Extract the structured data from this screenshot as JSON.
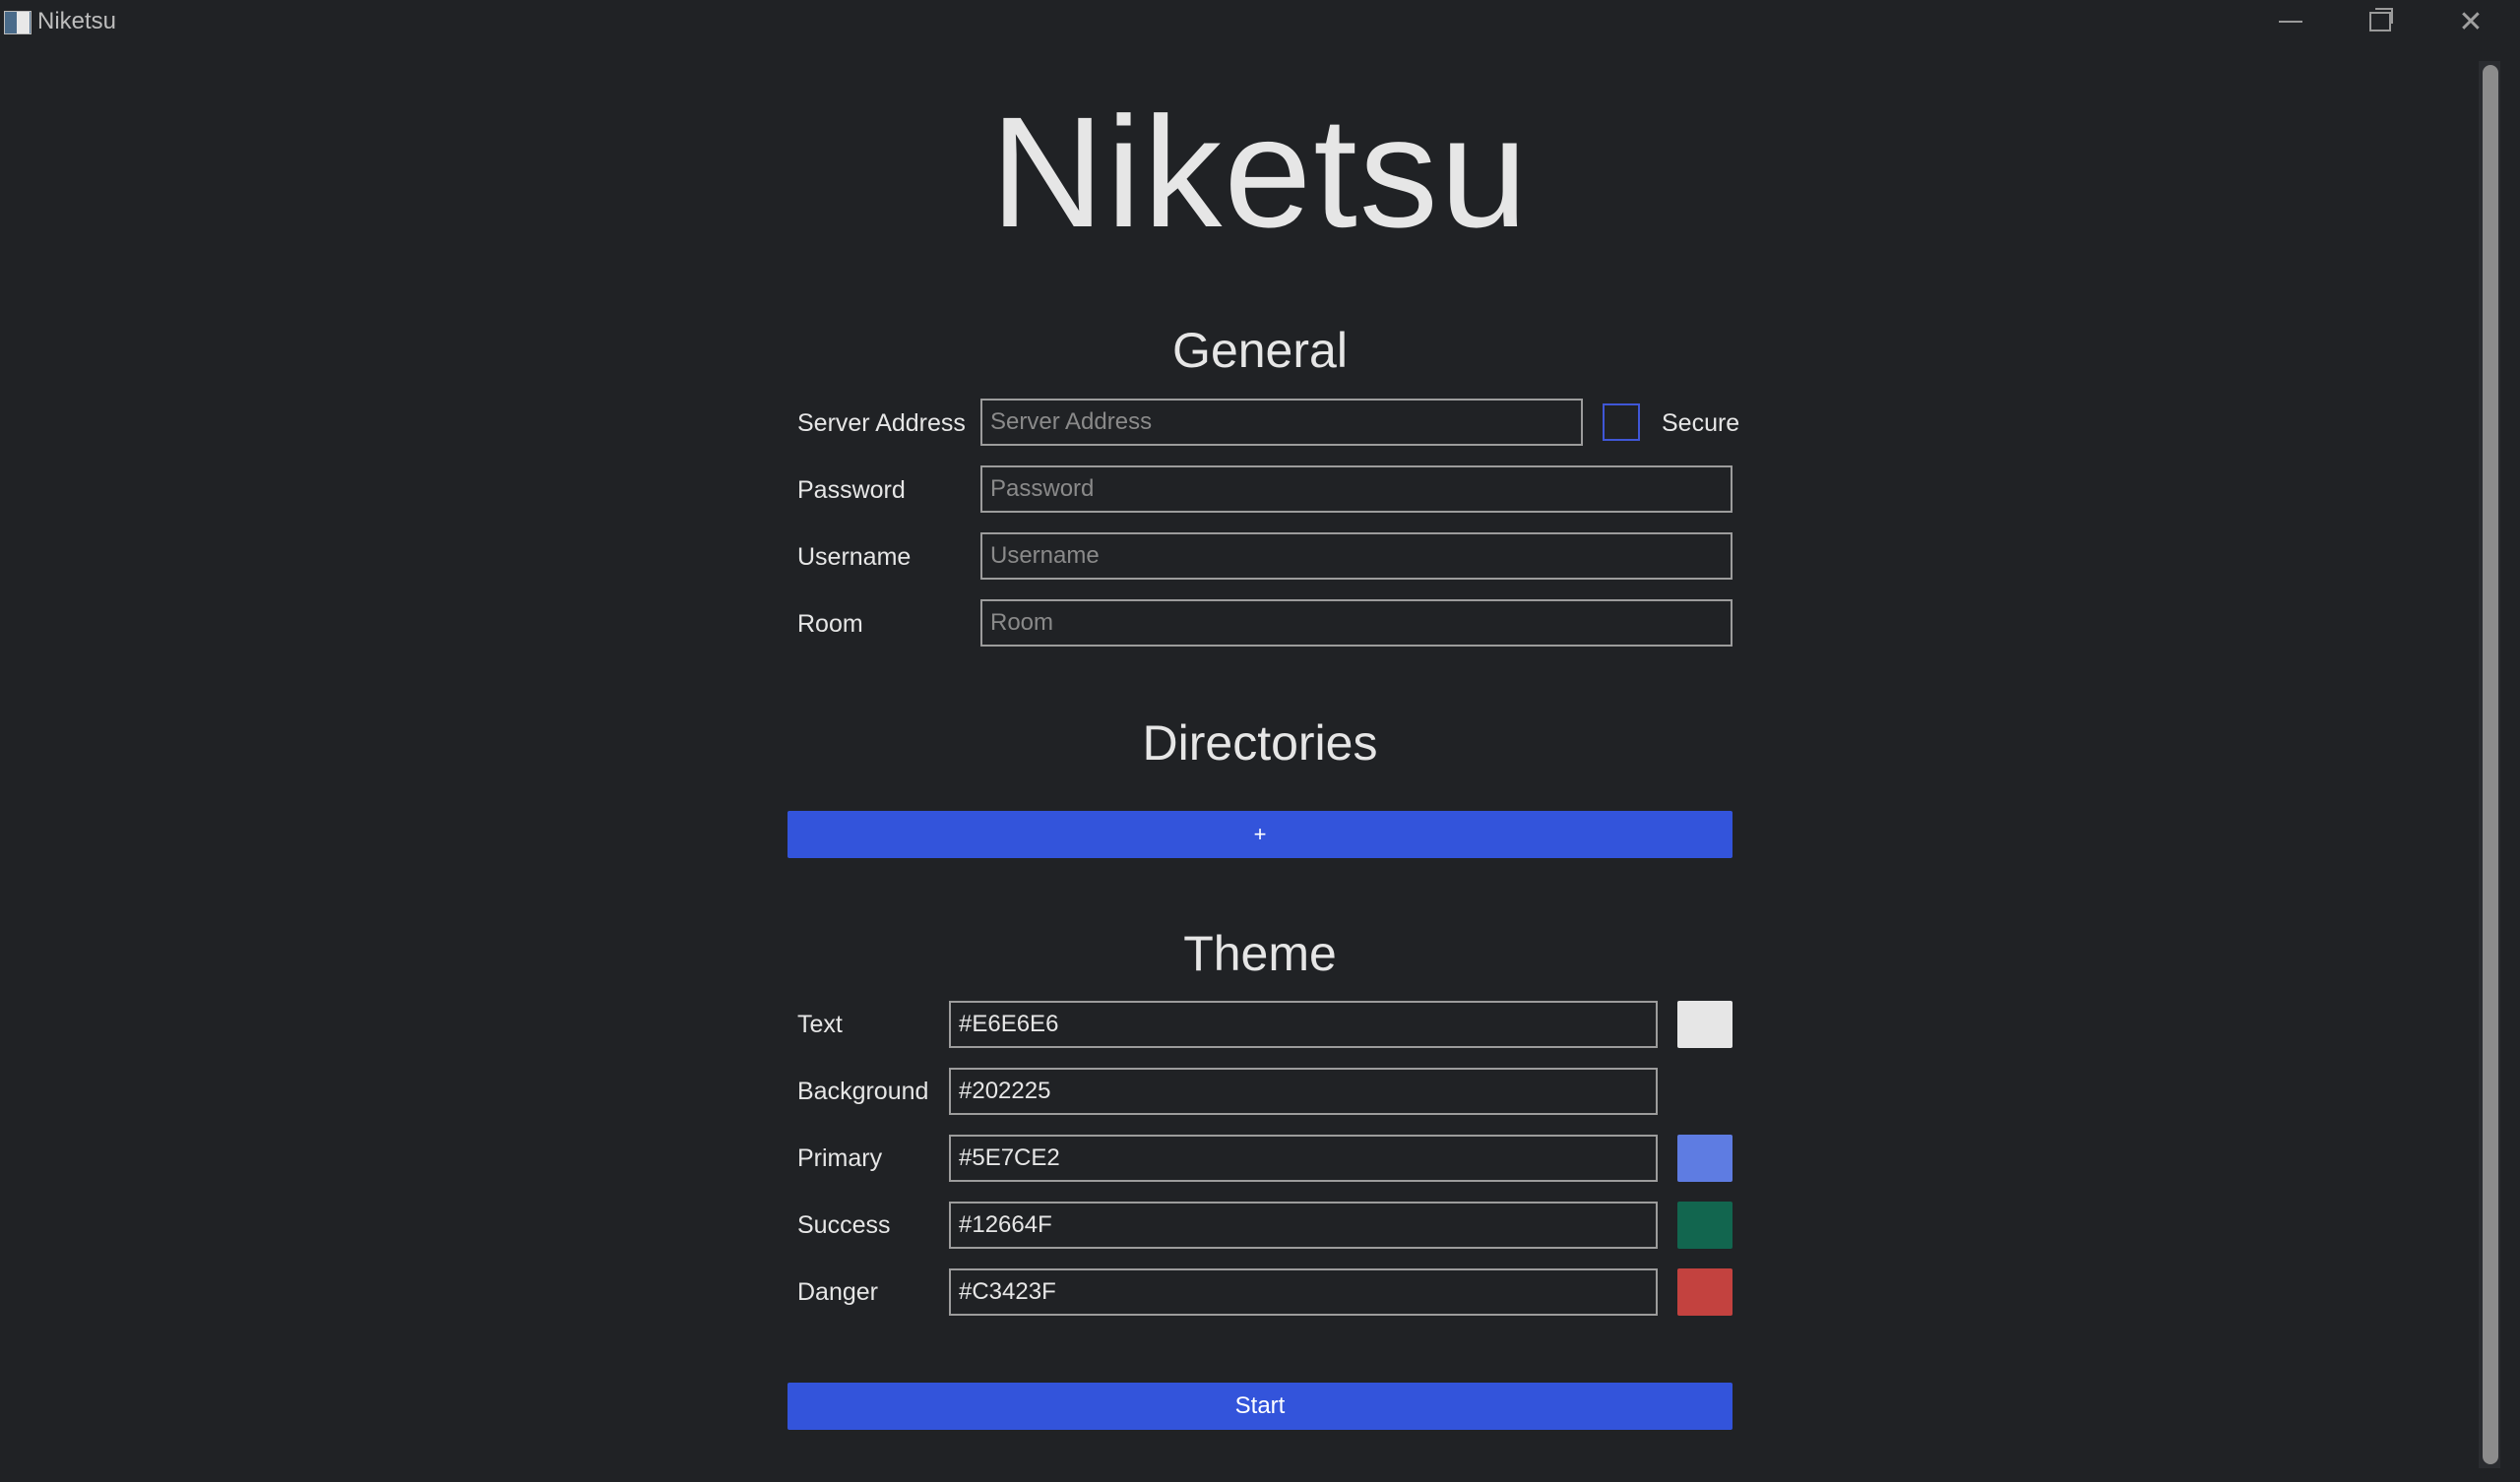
{
  "window": {
    "title": "Niketsu"
  },
  "app_title": "Niketsu",
  "general": {
    "heading": "General",
    "server_address": {
      "label": "Server Address",
      "placeholder": "Server Address",
      "value": ""
    },
    "secure": {
      "label": "Secure",
      "checked": false
    },
    "password": {
      "label": "Password",
      "placeholder": "Password",
      "value": ""
    },
    "username": {
      "label": "Username",
      "placeholder": "Username",
      "value": ""
    },
    "room": {
      "label": "Room",
      "placeholder": "Room",
      "value": ""
    }
  },
  "directories": {
    "heading": "Directories",
    "add_label": "+"
  },
  "theme": {
    "heading": "Theme",
    "items": [
      {
        "label": "Text",
        "value": "#E6E6E6",
        "swatch": "#E6E6E6"
      },
      {
        "label": "Background",
        "value": "#202225",
        "swatch": "#202225"
      },
      {
        "label": "Primary",
        "value": "#5E7CE2",
        "swatch": "#5E7CE2"
      },
      {
        "label": "Success",
        "value": "#12664F",
        "swatch": "#12664F"
      },
      {
        "label": "Danger",
        "value": "#C3423F",
        "swatch": "#C3423F"
      }
    ]
  },
  "start_label": "Start",
  "colors": {
    "accent": "#3354DB",
    "background": "#202225",
    "text": "#E6E6E6"
  }
}
